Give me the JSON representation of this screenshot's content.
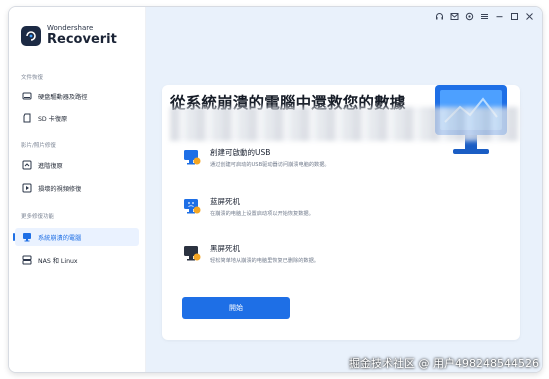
{
  "brand": {
    "top": "Wondershare",
    "name": "Recoverit"
  },
  "sidebar": {
    "sections": [
      {
        "label": "文件恢復"
      },
      {
        "label": "影片/照片修復"
      },
      {
        "label": "更多修復功能"
      }
    ],
    "items": [
      {
        "label": "硬盘驅動器及路徑",
        "icon": "hard-drive-icon"
      },
      {
        "label": "SD 卡復原",
        "icon": "sd-card-icon"
      },
      {
        "label": "進階復原",
        "icon": "advanced-recovery-icon"
      },
      {
        "label": "損壞的視頻修復",
        "icon": "video-repair-icon"
      },
      {
        "label": "系統崩潰的電腦",
        "icon": "crashed-computer-icon",
        "active": true
      },
      {
        "label": "NAS 和 Linux",
        "icon": "nas-icon"
      }
    ]
  },
  "main": {
    "title": "從系統崩潰的電腦中還救您的數據",
    "options": [
      {
        "title": "創建可啟動的USB",
        "desc": "通过创建可启动的USB驱动器访问崩溃电脑的数据。",
        "icon": "usb-computer-icon"
      },
      {
        "title": "蓝屏死机",
        "desc": "在崩溃的电脑上设置启动项以开始恢复数据。",
        "icon": "blue-screen-icon"
      },
      {
        "title": "黑屏死机",
        "desc": "轻松简单地从崩溃的电脑里恢复已删除的数据。",
        "icon": "black-screen-icon"
      }
    ],
    "start_label": "開始"
  },
  "watermark": "掘金技术社区 @ 用户498248544526",
  "colors": {
    "accent": "#1e6fe6",
    "sidebar_active_bg": "#eaf2ff",
    "main_bg": "#e9f1fb"
  }
}
